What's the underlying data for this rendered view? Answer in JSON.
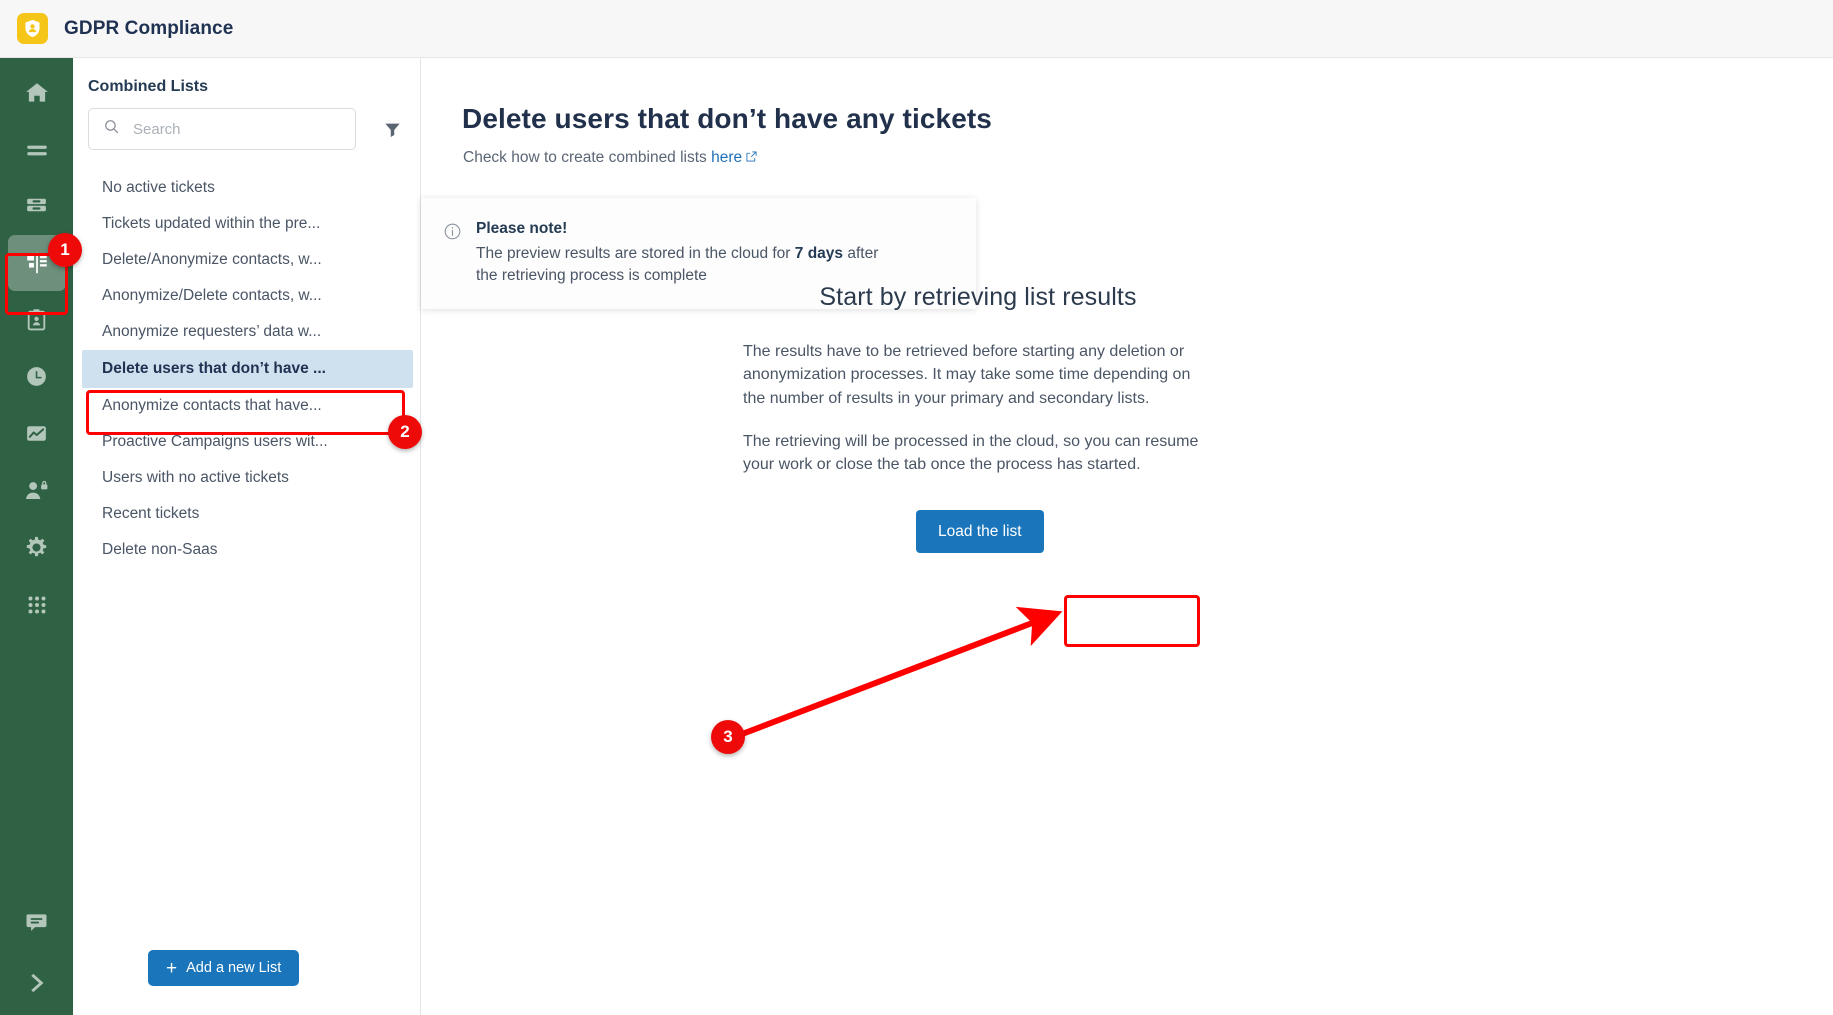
{
  "header": {
    "app_title": "GDPR Compliance",
    "logo_icon": "shield-person-icon"
  },
  "rail": {
    "items": [
      {
        "icon": "home-icon",
        "name": "home",
        "active": false
      },
      {
        "icon": "lines-icon",
        "name": "lists",
        "active": false
      },
      {
        "icon": "database-icon",
        "name": "database",
        "active": false
      },
      {
        "icon": "combined-lists-icon",
        "name": "combined-lists",
        "active": true
      },
      {
        "icon": "clipboard-person-icon",
        "name": "clipboard",
        "active": false
      },
      {
        "icon": "clock-icon",
        "name": "history",
        "active": false
      },
      {
        "icon": "chart-icon",
        "name": "reports",
        "active": false
      },
      {
        "icon": "user-lock-icon",
        "name": "permissions",
        "active": false
      },
      {
        "icon": "gear-icon",
        "name": "settings",
        "active": false
      },
      {
        "icon": "grid-dots-icon",
        "name": "apps",
        "active": false
      }
    ],
    "bottom_items": [
      {
        "icon": "chat-icon",
        "name": "chat"
      },
      {
        "icon": "chevron-right-icon",
        "name": "expand-sidebar"
      }
    ]
  },
  "panel": {
    "title": "Combined Lists",
    "search": {
      "placeholder": "Search",
      "value": "",
      "icon": "search-icon"
    },
    "filter_icon": "filter-icon",
    "items": [
      {
        "label": "No active tickets",
        "selected": false
      },
      {
        "label": "Tickets updated within the pre...",
        "selected": false
      },
      {
        "label": "Delete/Anonymize contacts, w...",
        "selected": false
      },
      {
        "label": "Anonymize/Delete contacts, w...",
        "selected": false
      },
      {
        "label": "Anonymize requesters’ data w...",
        "selected": false
      },
      {
        "label": "Delete users that don’t have ...",
        "selected": true
      },
      {
        "label": "Anonymize contacts that have...",
        "selected": false
      },
      {
        "label": "Proactive Campaigns users wit...",
        "selected": false
      },
      {
        "label": "Users with no active tickets",
        "selected": false
      },
      {
        "label": "Recent tickets",
        "selected": false
      },
      {
        "label": "Delete non-Saas",
        "selected": false
      }
    ],
    "add_button": {
      "label": "Add a new List",
      "plus": "+"
    }
  },
  "main": {
    "title": "Delete users that don’t have any tickets",
    "subtitle_prefix": "Check how to create combined lists ",
    "subtitle_link": "here",
    "note": {
      "icon": "info-circle-icon",
      "title": "Please note!",
      "body_part1": "The preview results are stored in the cloud for ",
      "body_strong": "7 days",
      "body_part2": " after the retrieving process is complete"
    },
    "center": {
      "heading": "Start by retrieving list results",
      "paragraph1": "The results have to be retrieved before starting any deletion or anonymization processes. It may take some time depending on the number of results in your primary and secondary lists.",
      "paragraph2": "The retrieving will be processed in the cloud, so you can resume your work or close the tab once the process has started."
    },
    "load_button": {
      "label": "Load the list"
    }
  },
  "annotations": {
    "badges": [
      {
        "number": "1",
        "target": "combined-lists-rail-icon"
      },
      {
        "number": "2",
        "target": "selected-list-item"
      },
      {
        "number": "3",
        "target": "load-the-list-button"
      }
    ],
    "accent_color": "#ef0a0a"
  },
  "colors": {
    "rail_green": "#2f6145",
    "rail_active_green": "#6e8f7c",
    "primary_blue": "#1b75bb",
    "selected_row_blue": "#cfe0ee",
    "logo_yellow": "#f5c518",
    "annotation_red": "#ef0a0a"
  }
}
